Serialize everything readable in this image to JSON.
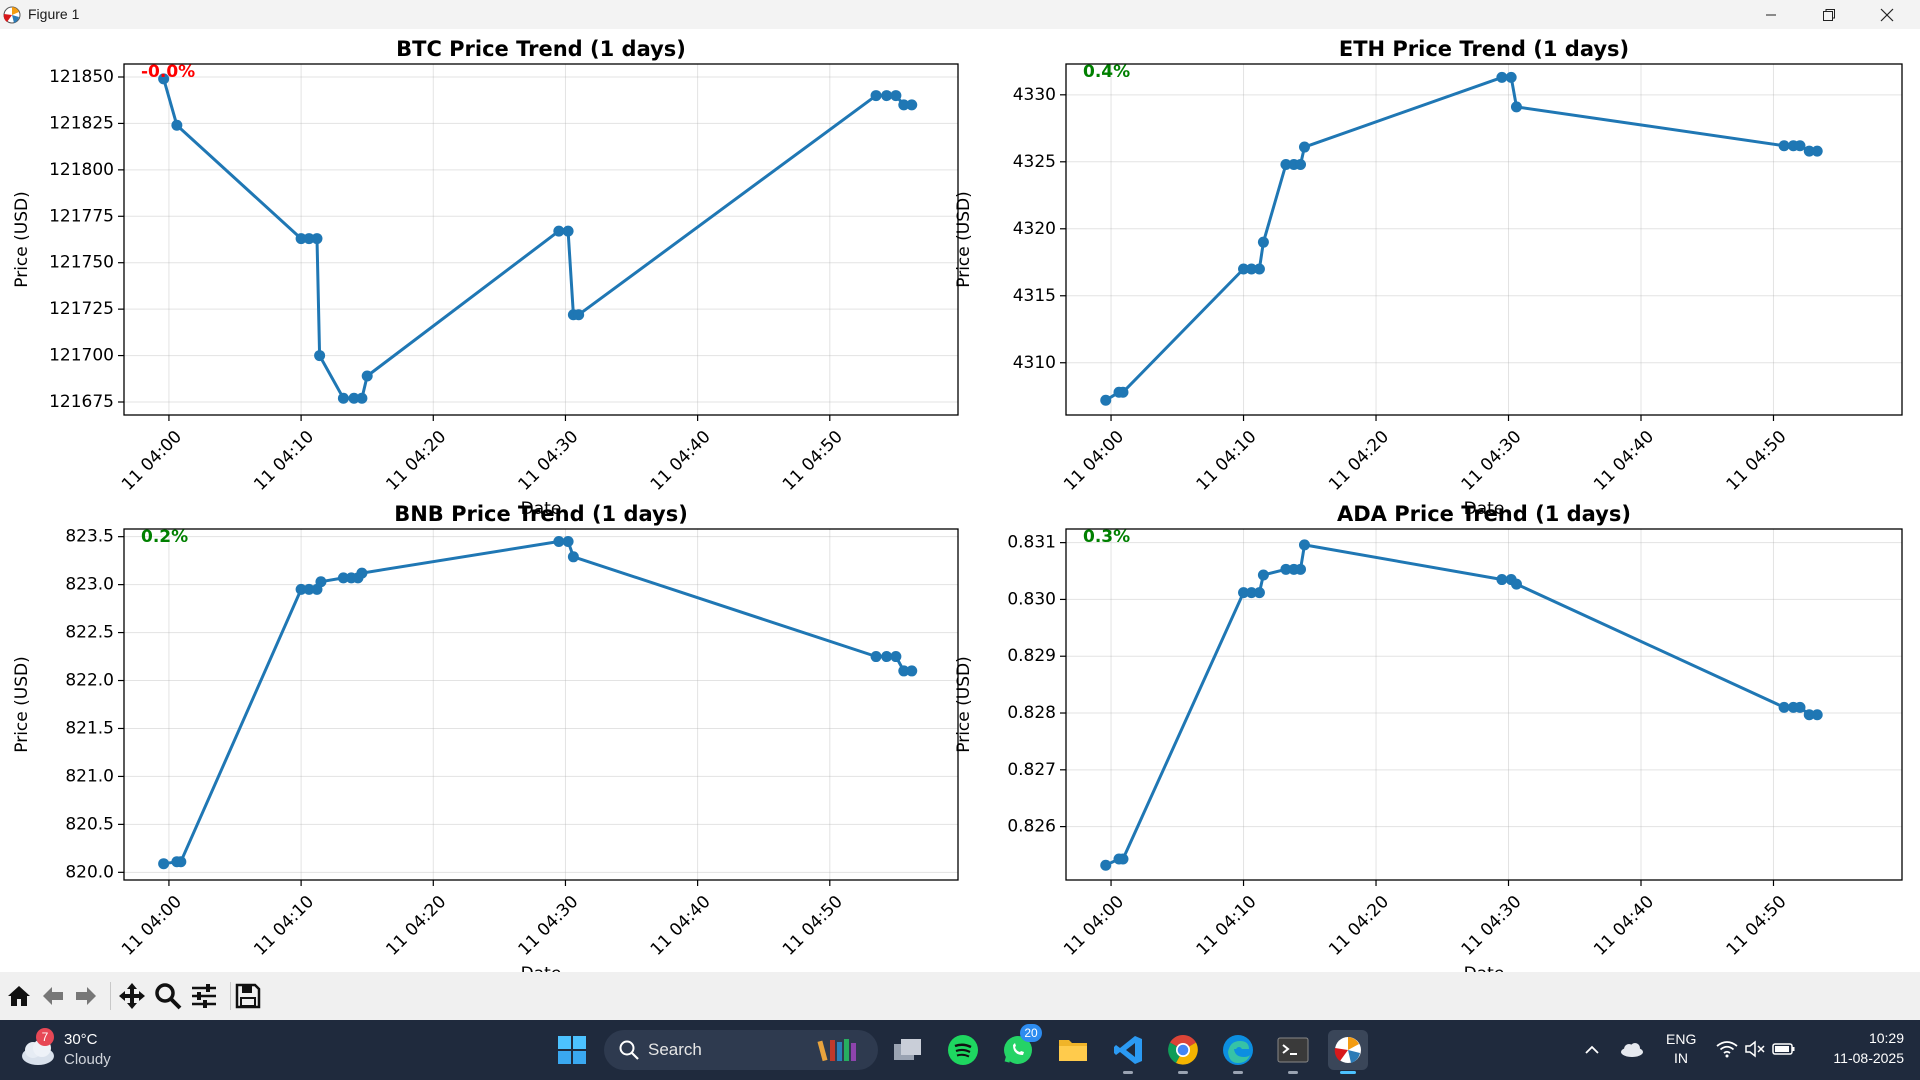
{
  "window": {
    "title": "Figure 1"
  },
  "figure": {
    "charts": [
      {
        "title": "BTC Price Trend (1 days)",
        "change": "-0.0%",
        "change_color": "#ff0000",
        "ylabel": "Price (USD)",
        "xlabel": "Date"
      },
      {
        "title": "ETH Price Trend (1 days)",
        "change": "0.4%",
        "change_color": "#008000",
        "ylabel": "Price (USD)",
        "xlabel": "Date"
      },
      {
        "title": "BNB Price Trend (1 days)",
        "change": "0.2%",
        "change_color": "#008000",
        "ylabel": "Price (USD)",
        "xlabel": "Date"
      },
      {
        "title": "ADA Price Trend (1 days)",
        "change": "0.3%",
        "change_color": "#008000",
        "ylabel": "Price (USD)",
        "xlabel": "Date"
      }
    ]
  },
  "chart_data": [
    {
      "type": "line",
      "title": "BTC Price Trend (1 days)",
      "xlabel": "Date",
      "ylabel": "Price (USD)",
      "x_ticks": [
        "11 04:00",
        "11 04:10",
        "11 04:20",
        "11 04:30",
        "11 04:40",
        "11 04:50"
      ],
      "x_tick_minutes": [
        240,
        250,
        260,
        270,
        280,
        290
      ],
      "xlim": [
        236.6,
        299.7
      ],
      "ylim": [
        121668,
        121857
      ],
      "y_ticks": [
        121675,
        121700,
        121725,
        121750,
        121775,
        121800,
        121825,
        121850
      ],
      "y_tick_labels": [
        "121675",
        "121700",
        "121725",
        "121750",
        "121775",
        "121800",
        "121825",
        "121850"
      ],
      "series": [
        {
          "color": "#1f77b4",
          "x_minutes": [
            239.6,
            240.6,
            250.0,
            250.6,
            251.2,
            251.4,
            253.2,
            254.0,
            254.6,
            255.0,
            269.5,
            270.2,
            270.6,
            271.0,
            293.5,
            294.3,
            295.0,
            295.6,
            296.2
          ],
          "y": [
            121849,
            121824,
            121763,
            121763,
            121763,
            121700,
            121677,
            121677,
            121677,
            121689,
            121767,
            121767,
            121722,
            121722,
            121840,
            121840,
            121840,
            121835,
            121835
          ]
        }
      ]
    },
    {
      "type": "line",
      "title": "ETH Price Trend (1 days)",
      "xlabel": "Date",
      "ylabel": "Price (USD)",
      "x_ticks": [
        "11 04:00",
        "11 04:10",
        "11 04:20",
        "11 04:30",
        "11 04:40",
        "11 04:50"
      ],
      "x_tick_minutes": [
        240,
        250,
        260,
        270,
        280,
        290
      ],
      "xlim": [
        236.6,
        299.7
      ],
      "ylim": [
        4306.1,
        4332.3
      ],
      "y_ticks": [
        4310,
        4315,
        4320,
        4325,
        4330
      ],
      "y_tick_labels": [
        "4310",
        "4315",
        "4320",
        "4325",
        "4330"
      ],
      "series": [
        {
          "color": "#1f77b4",
          "x_minutes": [
            239.6,
            240.6,
            240.9,
            250.0,
            250.6,
            251.2,
            251.5,
            253.2,
            253.8,
            254.3,
            254.6,
            269.5,
            270.2,
            270.6,
            290.8,
            291.5,
            292.0,
            292.7,
            293.3
          ],
          "y": [
            4307.2,
            4307.8,
            4307.8,
            4317.0,
            4317.0,
            4317.0,
            4319.0,
            4324.8,
            4324.8,
            4324.8,
            4326.1,
            4331.3,
            4331.3,
            4329.1,
            4326.2,
            4326.2,
            4326.2,
            4325.8,
            4325.8
          ]
        }
      ]
    },
    {
      "type": "line",
      "title": "BNB Price Trend (1 days)",
      "xlabel": "Date",
      "ylabel": "Price (USD)",
      "x_ticks": [
        "11 04:00",
        "11 04:10",
        "11 04:20",
        "11 04:30",
        "11 04:40",
        "11 04:50"
      ],
      "x_tick_minutes": [
        240,
        250,
        260,
        270,
        280,
        290
      ],
      "xlim": [
        236.6,
        299.7
      ],
      "ylim": [
        819.92,
        823.58
      ],
      "y_ticks": [
        820.0,
        820.5,
        821.0,
        821.5,
        822.0,
        822.5,
        823.0,
        823.5
      ],
      "y_tick_labels": [
        "820.0",
        "820.5",
        "821.0",
        "821.5",
        "822.0",
        "822.5",
        "823.0",
        "823.5"
      ],
      "series": [
        {
          "color": "#1f77b4",
          "x_minutes": [
            239.6,
            240.6,
            240.9,
            250.0,
            250.6,
            251.2,
            251.5,
            253.2,
            253.8,
            254.3,
            254.6,
            269.5,
            270.2,
            270.6,
            293.5,
            294.3,
            295.0,
            295.6,
            296.2
          ],
          "y": [
            820.09,
            820.11,
            820.11,
            822.95,
            822.95,
            822.95,
            823.03,
            823.07,
            823.07,
            823.07,
            823.12,
            823.45,
            823.45,
            823.29,
            822.25,
            822.25,
            822.25,
            822.1,
            822.1
          ]
        }
      ]
    },
    {
      "type": "line",
      "title": "ADA Price Trend (1 days)",
      "xlabel": "Date",
      "ylabel": "Price (USD)",
      "x_ticks": [
        "11 04:00",
        "11 04:10",
        "11 04:20",
        "11 04:30",
        "11 04:40",
        "11 04:50"
      ],
      "x_tick_minutes": [
        240,
        250,
        260,
        270,
        280,
        290
      ],
      "xlim": [
        236.6,
        299.7
      ],
      "ylim": [
        0.82506,
        0.83124
      ],
      "y_ticks": [
        0.826,
        0.827,
        0.828,
        0.829,
        0.83,
        0.831
      ],
      "y_tick_labels": [
        "0.826",
        "0.827",
        "0.828",
        "0.829",
        "0.830",
        "0.831"
      ],
      "series": [
        {
          "color": "#1f77b4",
          "x_minutes": [
            239.6,
            240.6,
            240.9,
            250.0,
            250.6,
            251.2,
            251.5,
            253.2,
            253.8,
            254.3,
            254.6,
            269.5,
            270.2,
            270.6,
            290.8,
            291.5,
            292.0,
            292.7,
            293.3
          ],
          "y": [
            0.82532,
            0.82543,
            0.82543,
            0.83012,
            0.83012,
            0.83012,
            0.83043,
            0.83053,
            0.83053,
            0.83053,
            0.83096,
            0.83035,
            0.83035,
            0.83027,
            0.8281,
            0.8281,
            0.8281,
            0.82797,
            0.82797
          ]
        }
      ]
    }
  ],
  "toolbar": {
    "buttons": [
      "home-icon",
      "back-icon",
      "forward-icon",
      "pan-icon",
      "zoom-icon",
      "configure-icon",
      "save-icon"
    ]
  },
  "taskbar": {
    "weather": {
      "badge": "7",
      "temp": "30°C",
      "desc": "Cloudy"
    },
    "search": {
      "label": "Search"
    },
    "whatsapp_badge": "20",
    "lang": {
      "line1": "ENG",
      "line2": "IN"
    },
    "clock": {
      "time": "10:29",
      "date": "11-08-2025"
    }
  }
}
